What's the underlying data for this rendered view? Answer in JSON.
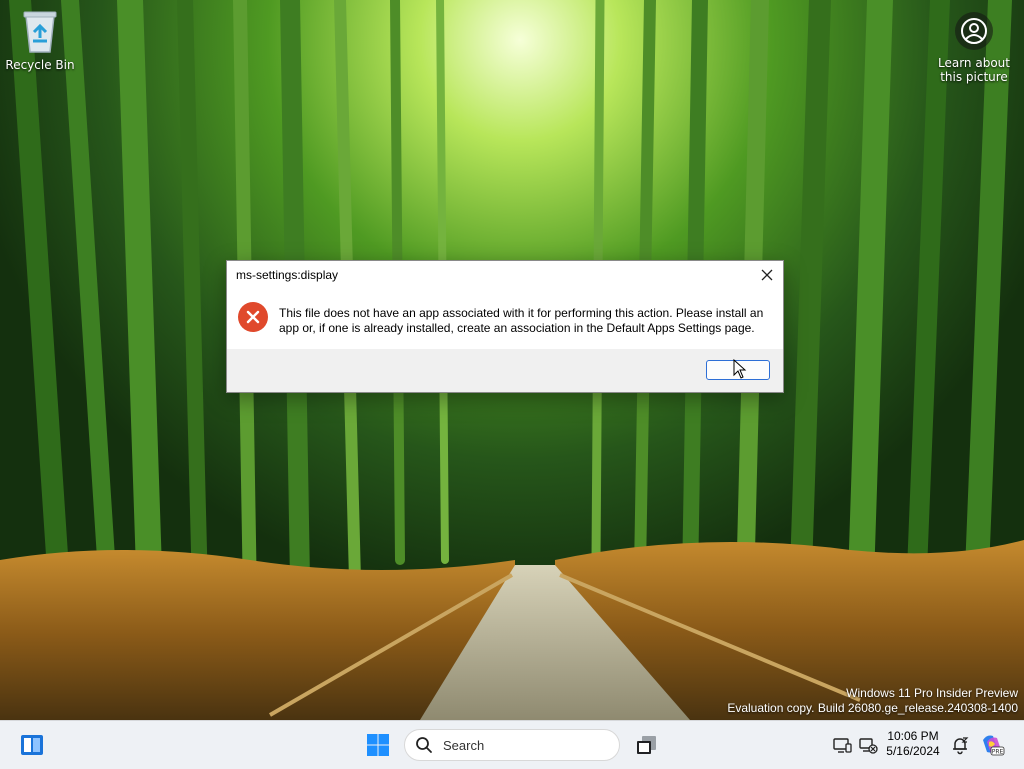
{
  "desktop": {
    "recycle_bin_label": "Recycle Bin",
    "learn_picture_label_line1": "Learn about",
    "learn_picture_label_line2": "this picture"
  },
  "watermark": {
    "line1": "Windows 11 Pro Insider Preview",
    "line2": "Evaluation copy. Build 26080.ge_release.240308-1400"
  },
  "dialog": {
    "title": "ms-settings:display",
    "message": "This file does not have an app associated with it for performing this action. Please install an app or, if one is already installed, create an association in the Default Apps Settings page.",
    "ok_label": ""
  },
  "taskbar": {
    "search_placeholder": "Search",
    "time": "10:06 PM",
    "date": "5/16/2024"
  },
  "colors": {
    "accent": "#0067c0",
    "error_red": "#e0492c",
    "focus_border": "#2e6fd6"
  }
}
